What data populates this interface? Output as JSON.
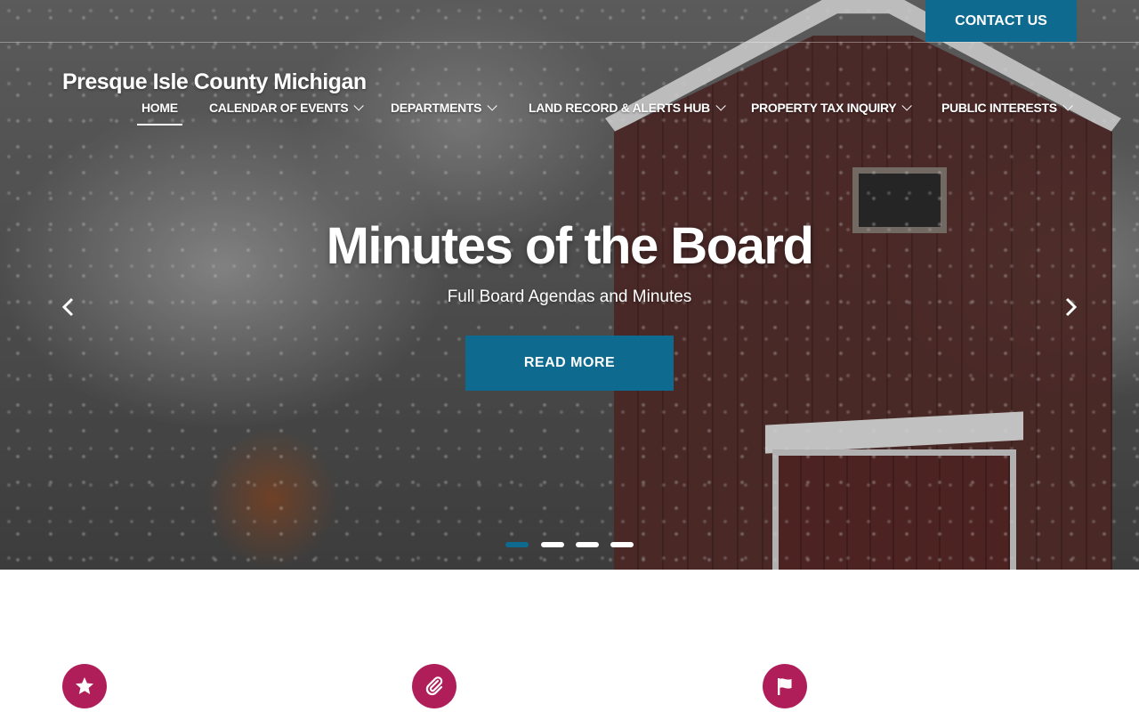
{
  "header": {
    "contact_label": "CONTACT US",
    "site_title": "Presque Isle County Michigan"
  },
  "nav": {
    "items": [
      {
        "label": "HOME",
        "active": true,
        "has_dropdown": false
      },
      {
        "label": "CALENDAR OF EVENTS",
        "active": false,
        "has_dropdown": true
      },
      {
        "label": "DEPARTMENTS",
        "active": false,
        "has_dropdown": true
      },
      {
        "label": "LAND RECORD & ALERTS HUB",
        "active": false,
        "has_dropdown": true
      },
      {
        "label": "PROPERTY TAX INQUIRY",
        "active": false,
        "has_dropdown": true
      },
      {
        "label": "PUBLIC INTERESTS",
        "active": false,
        "has_dropdown": true
      }
    ]
  },
  "slider": {
    "title": "Minutes of the Board",
    "subtitle": "Full Board Agendas and Minutes",
    "button_label": "READ MORE",
    "prev_icon": "chevron-left-icon",
    "next_icon": "chevron-right-icon",
    "slide_count": 4,
    "active_slide": 1
  },
  "features": [
    {
      "icon": "star-icon"
    },
    {
      "icon": "paperclip-icon"
    },
    {
      "icon": "flag-icon"
    }
  ],
  "colors": {
    "accent_blue": "#0e6a8f",
    "feature_magenta": "#b01e5a",
    "text_white": "#ffffff"
  }
}
